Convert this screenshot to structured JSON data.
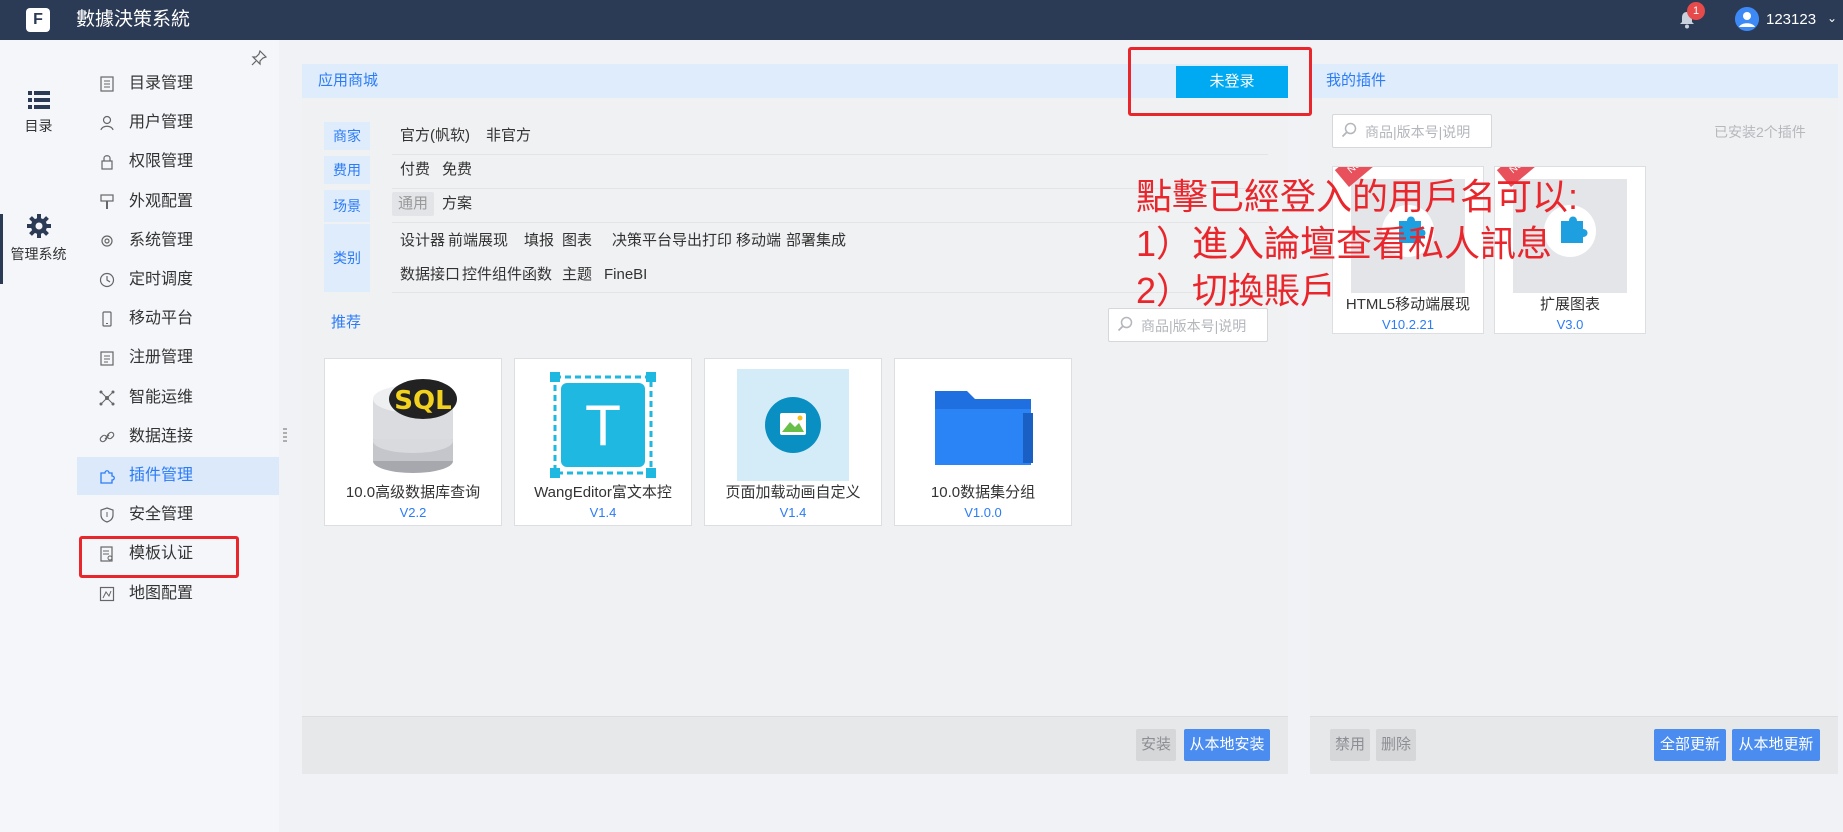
{
  "app": {
    "title": "數據決策系統",
    "logo_text": "F"
  },
  "topbar": {
    "notification_count": "1",
    "username": "123123",
    "caret": "⌄"
  },
  "rail": [
    {
      "label": "目录",
      "icon": "list-icon"
    },
    {
      "label": "管理系统",
      "icon": "gear-icon"
    }
  ],
  "sidebar": {
    "items": [
      {
        "label": "目录管理",
        "icon": "catalog-icon"
      },
      {
        "label": "用户管理",
        "icon": "user-icon"
      },
      {
        "label": "权限管理",
        "icon": "lock-icon"
      },
      {
        "label": "外观配置",
        "icon": "brush-icon"
      },
      {
        "label": "系统管理",
        "icon": "gear-icon"
      },
      {
        "label": "定时调度",
        "icon": "clock-icon"
      },
      {
        "label": "移动平台",
        "icon": "mobile-icon"
      },
      {
        "label": "注册管理",
        "icon": "register-icon"
      },
      {
        "label": "智能运维",
        "icon": "ops-icon"
      },
      {
        "label": "数据连接",
        "icon": "link-icon"
      },
      {
        "label": "插件管理",
        "icon": "puzzle-icon"
      },
      {
        "label": "安全管理",
        "icon": "shield-icon"
      },
      {
        "label": "模板认证",
        "icon": "certificate-icon"
      },
      {
        "label": "地图配置",
        "icon": "map-icon"
      }
    ],
    "active": "插件管理"
  },
  "store": {
    "title": "应用商城",
    "login_button": "未登录",
    "filters": {
      "vendor": {
        "label": "商家",
        "options": [
          "官方(帆软)",
          "非官方"
        ]
      },
      "fee": {
        "label": "费用",
        "options": [
          "付费",
          "免费"
        ]
      },
      "scene": {
        "label": "场景",
        "options": [
          "通用",
          "方案"
        ],
        "selected": "通用"
      },
      "category": {
        "label": "类别",
        "row1": [
          "设计器",
          "前端展现",
          "填报",
          "图表",
          "决策平台",
          "导出打印",
          "移动端",
          "部署集成"
        ],
        "row2": [
          "数据接口",
          "控件组件",
          "函数",
          "主题",
          "FineBI"
        ]
      }
    },
    "recommend_label": "推荐",
    "search_placeholder": "商品|版本号|说明",
    "cards": [
      {
        "name": "10.0高级数据库查询",
        "version": "V2.2",
        "thumb_text": "SQL"
      },
      {
        "name": "WangEditor富文本控",
        "version": "V1.4",
        "thumb_text": "T"
      },
      {
        "name": "页面加载动画自定义",
        "version": "V1.4"
      },
      {
        "name": "10.0数据集分组",
        "version": "V1.0.0"
      }
    ],
    "footer": {
      "install": "安装",
      "install_local": "从本地安装"
    }
  },
  "mine": {
    "title": "我的插件",
    "search_placeholder": "商品|版本号|说明",
    "installed_count": "已安装2个插件",
    "cards": [
      {
        "name": "HTML5移动端展现",
        "version": "V10.2.21",
        "ribbon": "New"
      },
      {
        "name": "扩展图表",
        "version": "V3.0",
        "ribbon": "New"
      }
    ],
    "footer": {
      "disable": "禁用",
      "delete": "删除",
      "update_all": "全部更新",
      "update_local": "从本地更新"
    }
  },
  "annotation": {
    "line1": "點擊已經登入的用戶名可以:",
    "line2": "1）進入論壇查看私人訊息",
    "line3": "2）切換賬戶"
  },
  "colors": {
    "topbar": "#2b3a55",
    "accent": "#2b7cf6",
    "annotation": "#e8262b",
    "login_button": "#00aaf2"
  }
}
